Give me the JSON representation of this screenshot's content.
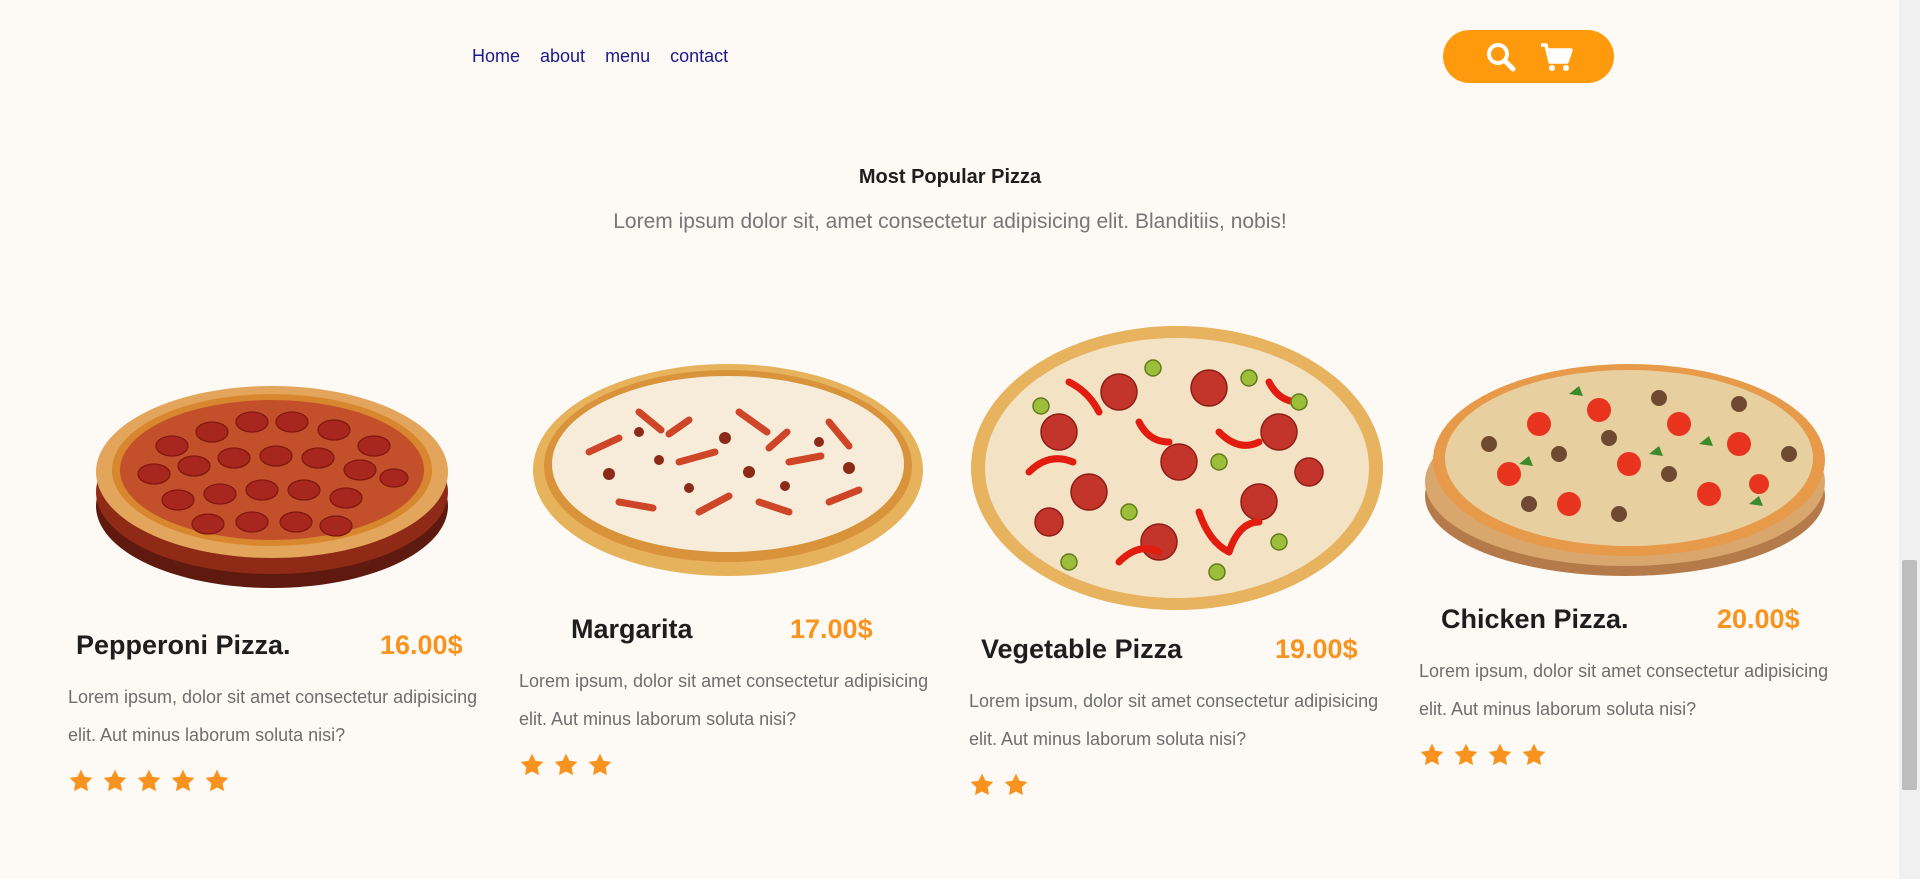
{
  "nav": {
    "links": [
      "Home",
      "about",
      "menu",
      "contact"
    ],
    "search_icon": "search-icon",
    "cart_icon": "shopping-cart-icon"
  },
  "section": {
    "title": "Most Popular Pizza",
    "subtitle": "Lorem ipsum dolor sit, amet consectetur adipisicing elit. Blanditiis, nobis!"
  },
  "pizzas": [
    {
      "name": "Pepperoni Pizza.",
      "price": "16.00$",
      "description": "Lorem ipsum, dolor sit amet consectetur adipisicing elit. Aut minus laborum soluta nisi?",
      "rating": 5
    },
    {
      "name": "Margarita",
      "price": "17.00$",
      "description": "Lorem ipsum, dolor sit amet consectetur adipisicing elit. Aut minus laborum soluta nisi?",
      "rating": 3
    },
    {
      "name": "Vegetable Pizza",
      "price": "19.00$",
      "description": "Lorem ipsum, dolor sit amet consectetur adipisicing elit. Aut minus laborum soluta nisi?",
      "rating": 2
    },
    {
      "name": "Chicken Pizza.",
      "price": "20.00$",
      "description": "Lorem ipsum, dolor sit amet consectetur adipisicing elit. Aut minus laborum soluta nisi?",
      "rating": 4
    }
  ],
  "colors": {
    "accent": "#f7931e",
    "button": "#ff9a0d",
    "nav_link": "#1a1a8c",
    "background": "#fdfaf5"
  }
}
